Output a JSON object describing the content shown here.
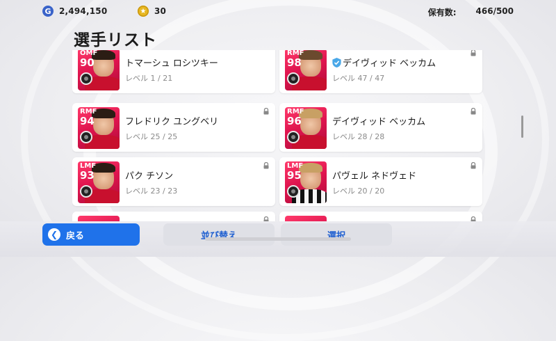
{
  "currency": {
    "gp": "2,494,150",
    "gp_icon": "G",
    "coins": "30",
    "coin_icon": "★"
  },
  "owned": {
    "label": "保有数:",
    "value": "466/500"
  },
  "page_title": "選手リスト",
  "players": [
    {
      "position": "OMF",
      "rating": "90",
      "name": "トマーシュ ロシツキー",
      "level": "レベル 1 / 21",
      "locked": false,
      "verified": false,
      "hair": "dark",
      "kit": "red"
    },
    {
      "position": "RMF",
      "rating": "98",
      "name": "デイヴィッド ベッカム",
      "level": "レベル 47 / 47",
      "locked": true,
      "verified": true,
      "hair": "brown",
      "kit": "red"
    },
    {
      "position": "RMF",
      "rating": "94",
      "name": "フレドリク ユングベリ",
      "level": "レベル 25 / 25",
      "locked": true,
      "verified": false,
      "hair": "dark",
      "kit": "red"
    },
    {
      "position": "RMF",
      "rating": "96",
      "name": "デイヴィッド ベッカム",
      "level": "レベル 28 / 28",
      "locked": true,
      "verified": false,
      "hair": "blond",
      "kit": "red"
    },
    {
      "position": "LMF",
      "rating": "93",
      "name": "パク チソン",
      "level": "レベル 23 / 23",
      "locked": true,
      "verified": false,
      "hair": "dark",
      "kit": "red"
    },
    {
      "position": "LMF",
      "rating": "95",
      "name": "パヴェル ネドヴェド",
      "level": "レベル 20 / 20",
      "locked": true,
      "verified": false,
      "hair": "blond",
      "kit": "stripe"
    }
  ],
  "buttons": {
    "back": "戻る",
    "sort": "並び替え",
    "select": "選択"
  },
  "colors": {
    "accent": "#1f72ea",
    "card_bg": "#e0154f"
  }
}
